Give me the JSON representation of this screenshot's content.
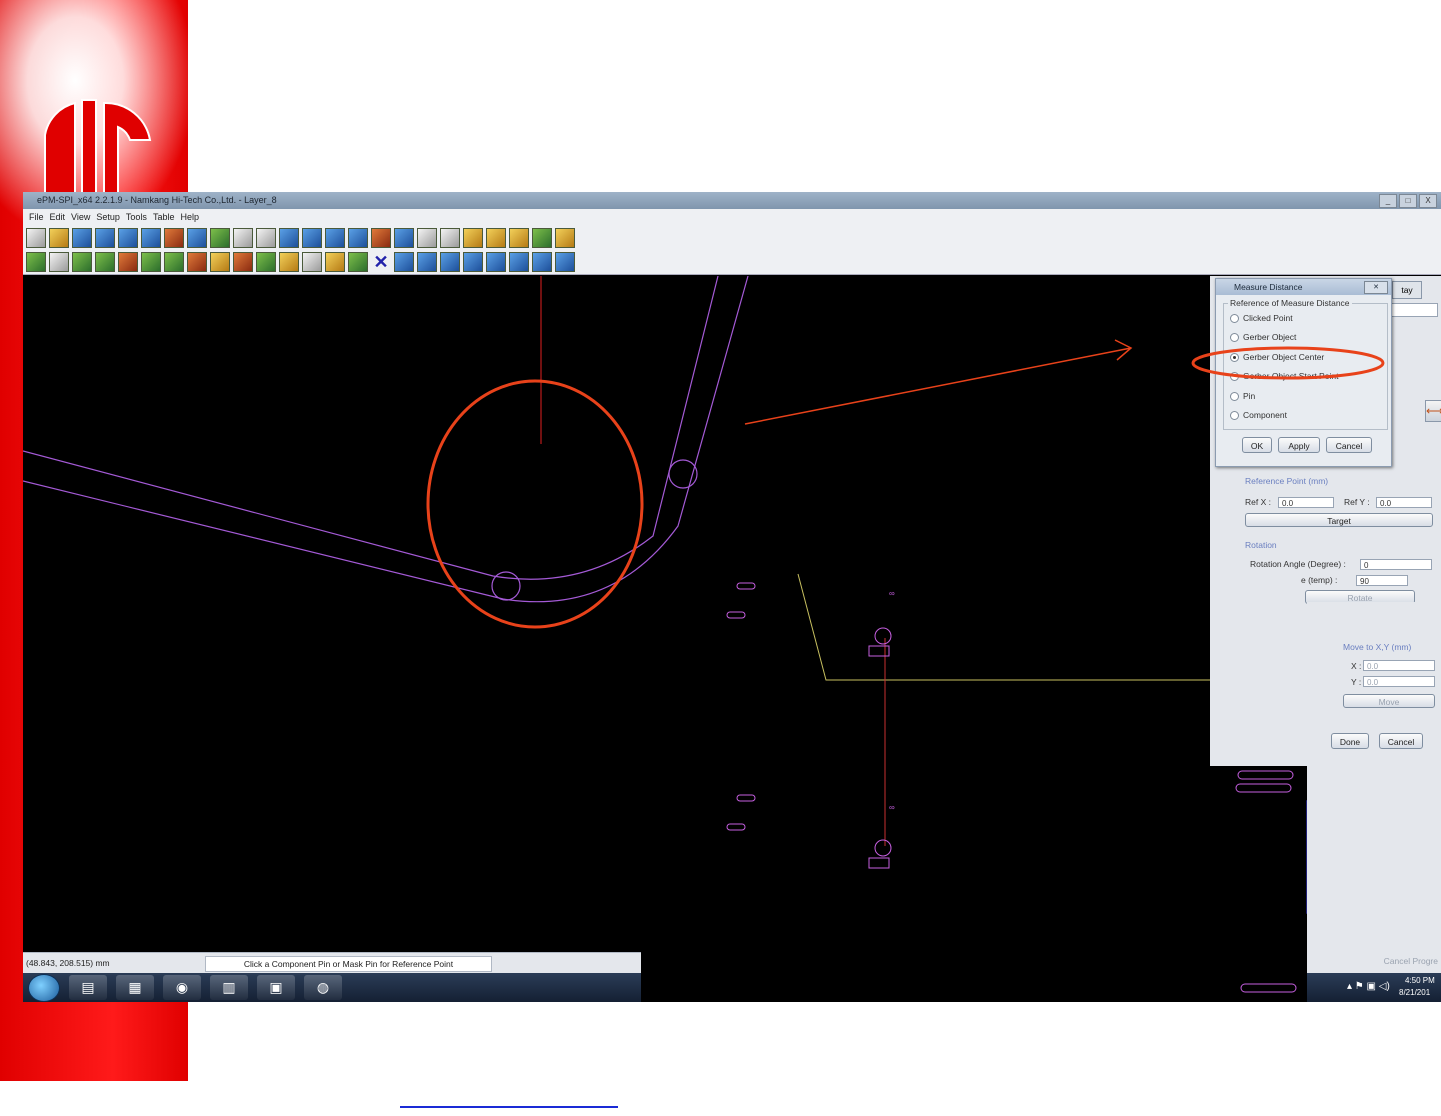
{
  "window": {
    "title": "ePM-SPI_x64 2.2.1.9 - Namkang Hi-Tech Co.,Ltd. - Layer_8",
    "controls": [
      "_",
      "□",
      "X"
    ]
  },
  "menu": [
    "File",
    "Edit",
    "View",
    "Setup",
    "Tools",
    "Table",
    "Help"
  ],
  "dialog": {
    "title": "Measure Distance",
    "group_title": "Reference of Measure Distance",
    "options": [
      {
        "label": "Clicked Point",
        "selected": false
      },
      {
        "label": "Gerber Object",
        "selected": false
      },
      {
        "label": "Gerber Object Center",
        "selected": true
      },
      {
        "label": "Gerber Object Start Point",
        "selected": false
      },
      {
        "label": "Pin",
        "selected": false
      },
      {
        "label": "Component",
        "selected": false
      }
    ],
    "buttons": {
      "ok": "OK",
      "apply": "Apply",
      "cancel": "Cancel"
    }
  },
  "panel": {
    "tab_label": "tay",
    "reference_point": {
      "title": "Reference Point (mm)",
      "ref_x_label": "Ref X :",
      "ref_x_value": "0.0",
      "ref_y_label": "Ref Y :",
      "ref_y_value": "0.0",
      "target_button": "Target"
    },
    "rotation": {
      "title": "Rotation",
      "angle_label": "Rotation Angle (Degree) :",
      "angle_value": "0",
      "temp_label": "e (temp) :",
      "temp_value": "90",
      "rotate_button": "Rotate"
    },
    "move": {
      "title": "Move to X,Y (mm)",
      "x_label": "X :",
      "x_value": "0.0",
      "y_label": "Y :",
      "y_value": "0.0",
      "move_button": "Move"
    },
    "done_button": "Done",
    "cancel_button": "Cancel",
    "cancel_progress": "Cancel Progre"
  },
  "status": {
    "coords": "(48.843, 208.515) mm",
    "hint": "Click a Component Pin or Mask Pin for Reference Point"
  },
  "tray": {
    "time": "4:50 PM",
    "date": "8/21/201"
  },
  "colors": {
    "slide_red": "#ff0000",
    "annotation_red": "#e8421a",
    "gerber_outline": "#a45ad6",
    "pad_outline": "#c65fe0",
    "measure_line": "#c8c060",
    "canvas_bg": "#000000"
  }
}
